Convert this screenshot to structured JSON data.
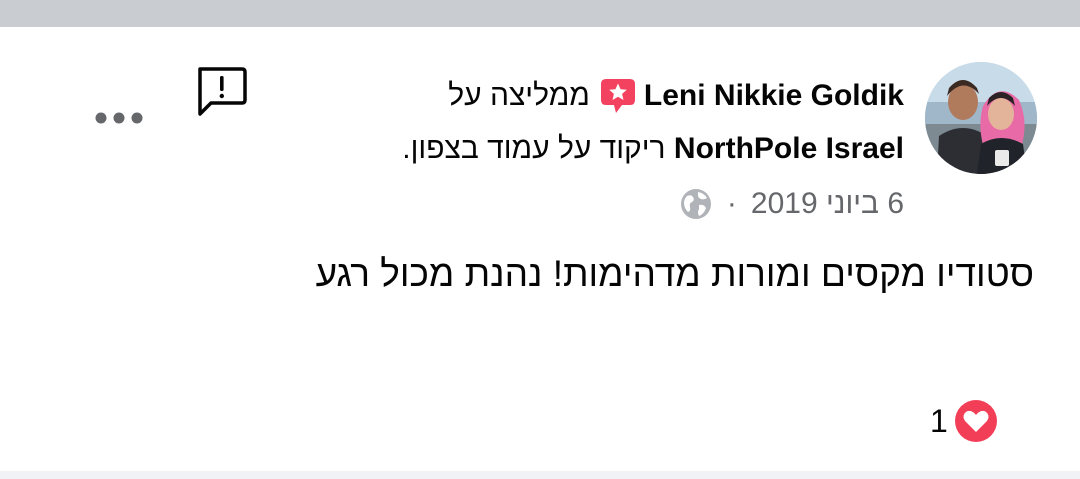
{
  "post": {
    "author": "Leni Nikkie Goldik",
    "recommends_text": "ממליצה על",
    "page_name": "NorthPole Israel",
    "description_text": "ריקוד על עמוד בצפון.",
    "date": "6 ביוני 2019",
    "separator": "·",
    "privacy_icon": "globe-icon",
    "text": "סטודיו מקסים ומורות מדהימות! נהנת מכול רגע"
  },
  "reactions": {
    "count": "1",
    "icon": "heart-reaction-icon"
  },
  "actions": {
    "report_icon": "report-icon",
    "more_icon": "more-options-icon"
  },
  "colors": {
    "text": "#050505",
    "meta": "#65676b",
    "badge": "#f3425f",
    "heart": "#f33e58",
    "top_bar": "#c9ccd1"
  }
}
